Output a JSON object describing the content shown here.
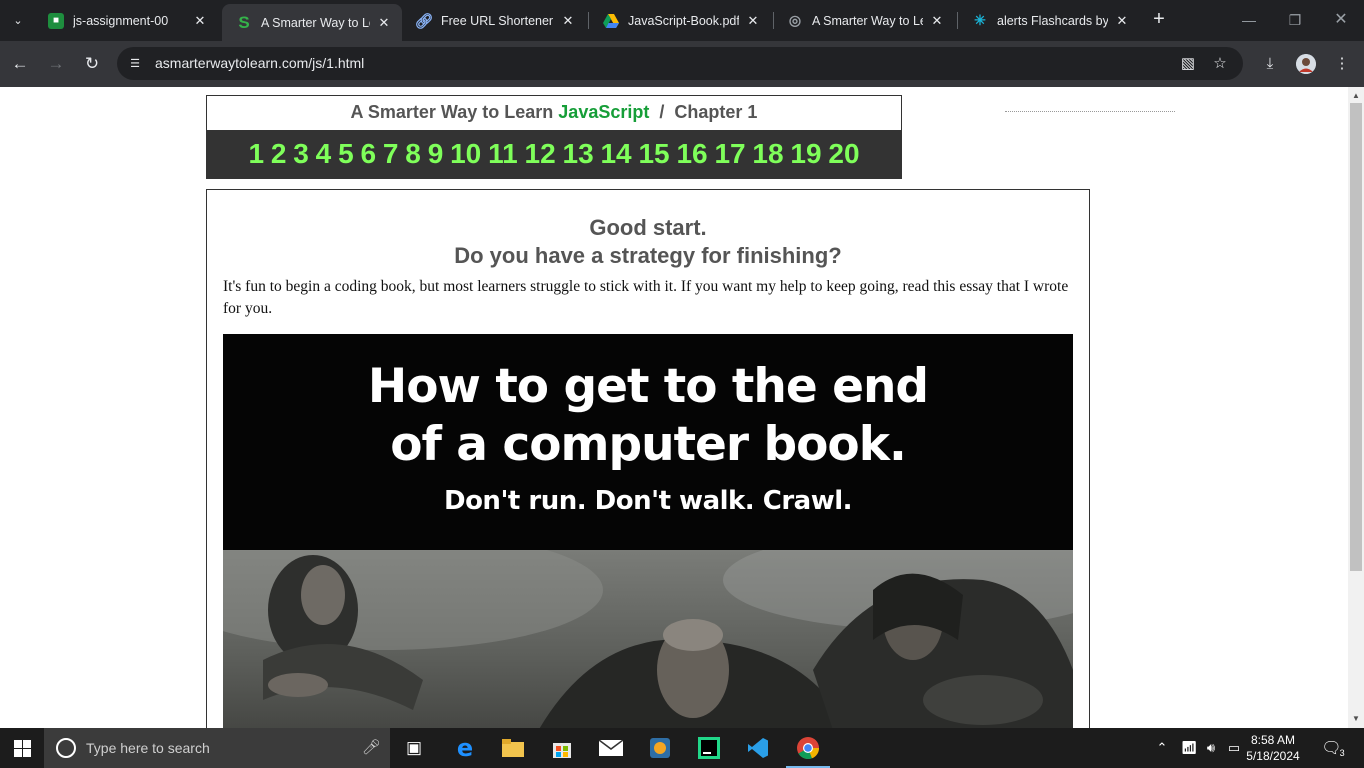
{
  "browser": {
    "tabs": [
      {
        "title": "js-assignment-00",
        "favicon": "google-classroom-icon",
        "active": false
      },
      {
        "title": "A Smarter Way to Lea",
        "favicon": "smarter-way-s-icon",
        "active": true
      },
      {
        "title": "Free URL Shortener",
        "favicon": "link-icon",
        "active": false
      },
      {
        "title": "JavaScript-Book.pdf -",
        "favicon": "google-drive-icon",
        "active": false
      },
      {
        "title": "A Smarter Way to Lea",
        "favicon": "globe-icon",
        "active": false
      },
      {
        "title": "alerts Flashcards by A",
        "favicon": "brainscape-icon",
        "active": false
      }
    ],
    "url": "asmarterwaytolearn.com/js/1.html"
  },
  "page": {
    "header": {
      "prefix": "A Smarter Way to Learn",
      "language": "JavaScript",
      "separator": "/",
      "chapter": "Chapter 1",
      "chapter_links": [
        "1",
        "2",
        "3",
        "4",
        "5",
        "6",
        "7",
        "8",
        "9",
        "10",
        "11",
        "12",
        "13",
        "14",
        "15",
        "16",
        "17",
        "18",
        "19",
        "20"
      ]
    },
    "heading_line1": "Good start.",
    "heading_line2": "Do you have a strategy for finishing?",
    "intro_text": "It's fun to begin a coding book, but most learners struggle to stick with it. If you want my help to keep going, read this essay that I wrote for you.",
    "banner": {
      "line1": "How to get to the end",
      "line2": "of a computer book.",
      "subline": "Don't run. Don't walk. Crawl."
    }
  },
  "taskbar": {
    "search_placeholder": "Type here to search",
    "time": "8:58 AM",
    "date": "5/18/2024",
    "notification_count": "3"
  },
  "colors": {
    "chapter_link": "#7fff5a",
    "javascript_word": "#169e38",
    "header_bg": "#333333",
    "browser_dark": "#202124"
  }
}
